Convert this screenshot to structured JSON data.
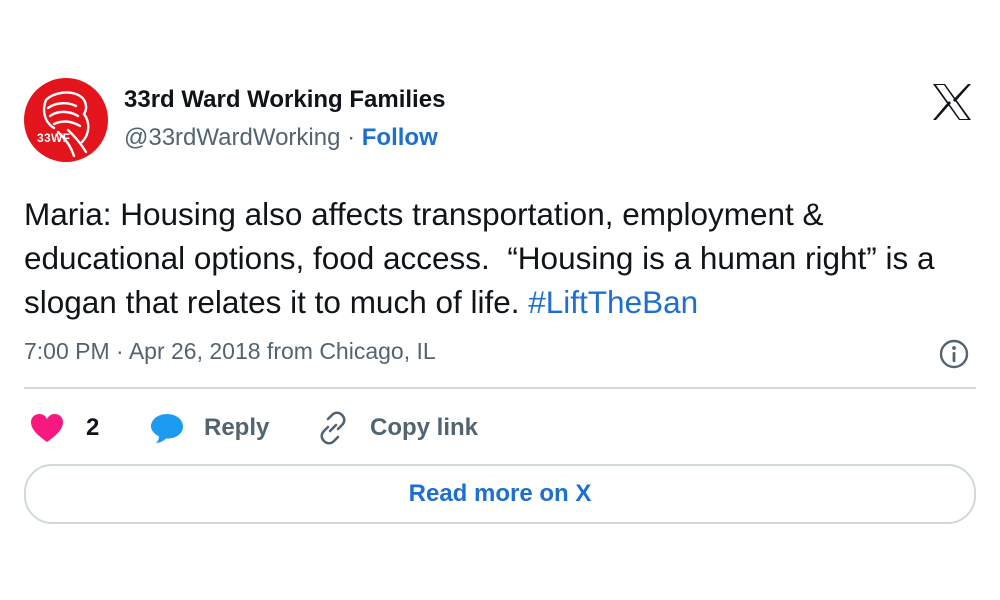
{
  "author": {
    "display_name": "33rd Ward Working Families",
    "handle": "@33rdWardWorking",
    "separator": " · ",
    "follow_label": "Follow",
    "avatar_text": "33WF",
    "avatar_color": "#e3141b"
  },
  "tweet": {
    "text_main": "Maria: Housing also affects transportation, employment & educational options, food access.  “Housing is a human right” is a slogan that relates it to much of life. ",
    "hashtag": "#LiftTheBan",
    "timestamp": "7:00 PM · Apr 26, 2018 from Chicago, IL"
  },
  "actions": {
    "like_count": "2",
    "reply_label": "Reply",
    "copy_link_label": "Copy link"
  },
  "read_more_label": "Read more on X",
  "icons": {
    "brand": "x-logo-icon",
    "info": "info-icon",
    "like": "heart-icon",
    "reply": "speech-bubble-icon",
    "copy": "link-icon"
  },
  "colors": {
    "link_blue": "#1d6fd1",
    "like_pink": "#f91880",
    "reply_blue": "#1d9bf0",
    "text_primary": "#0f1419",
    "text_secondary": "#536471",
    "divider": "#cfd9de"
  }
}
